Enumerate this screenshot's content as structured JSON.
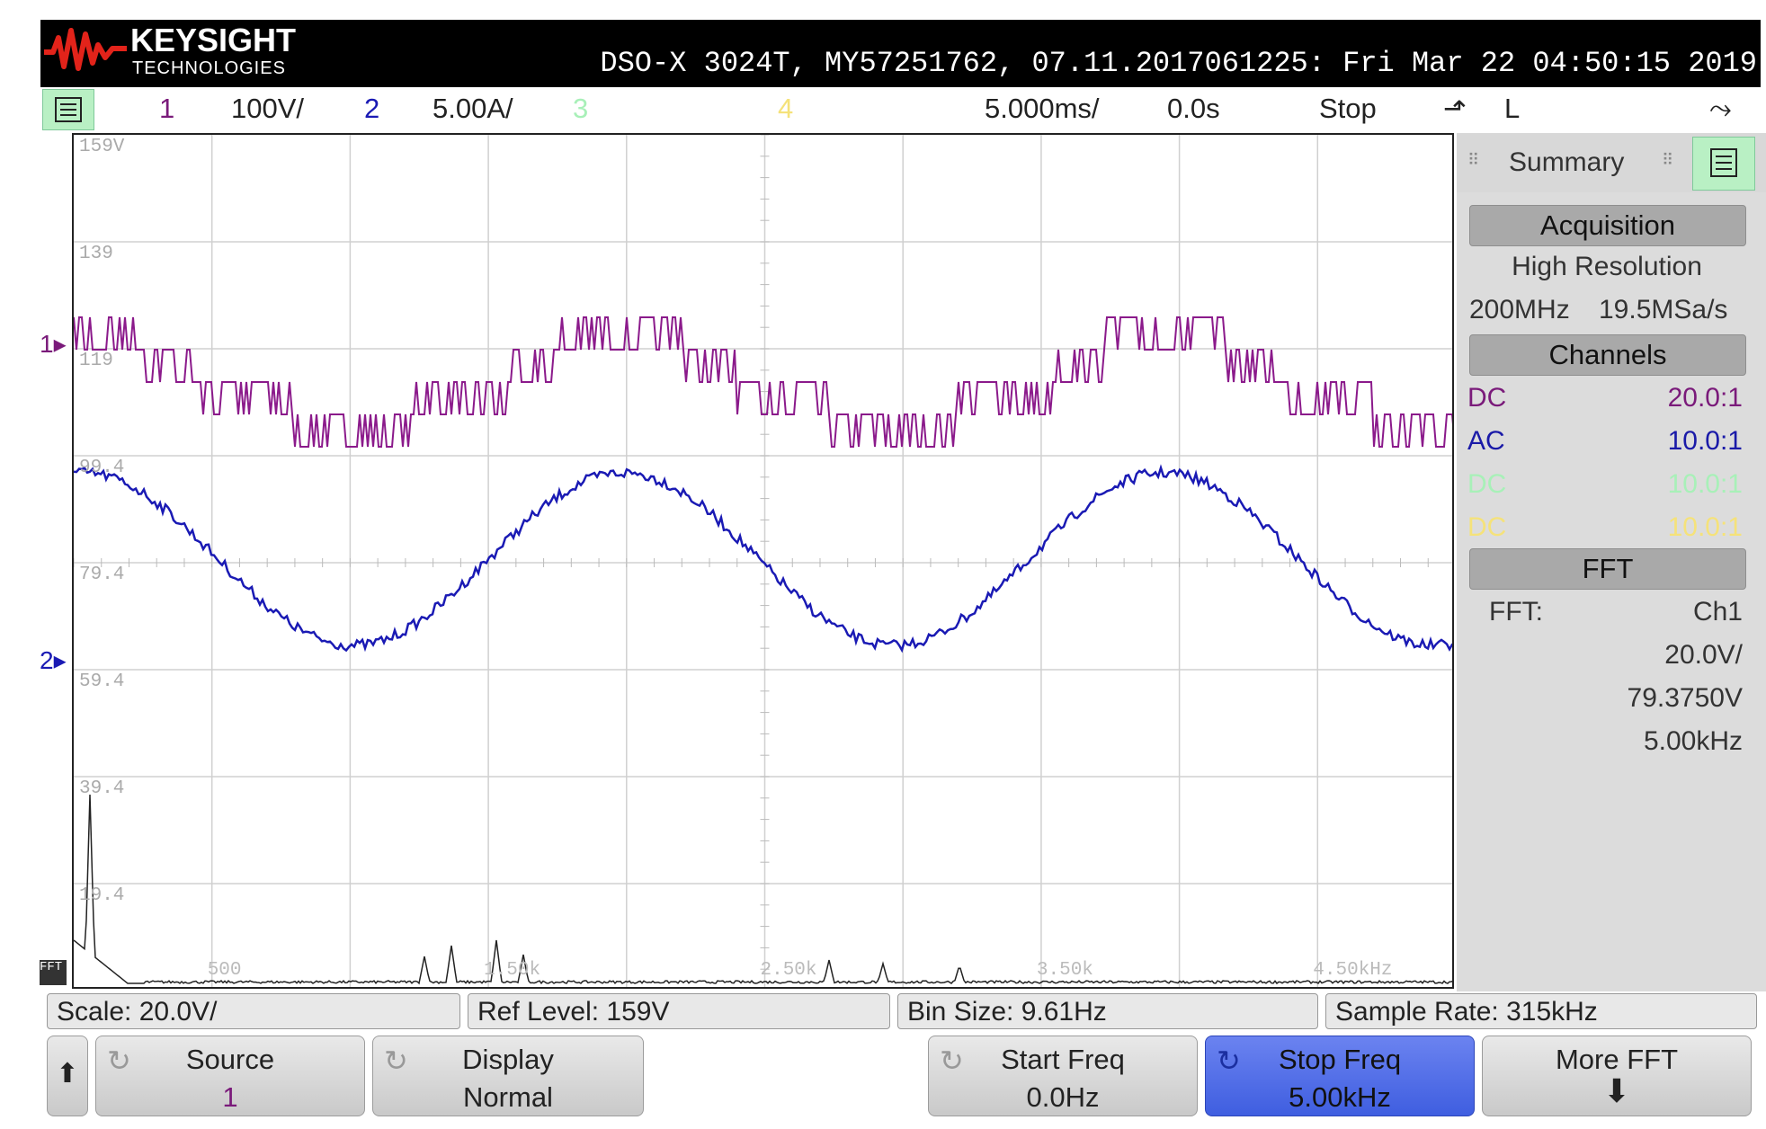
{
  "header": {
    "brand": "KEYSIGHT",
    "brand_sub": "TECHNOLOGIES",
    "instrument": "DSO-X 3024T, MY57251762, 07.11.2017061225: Fri Mar 22 04:50:15 2019"
  },
  "status": {
    "ch1_num": "1",
    "ch1_scale": "100V/",
    "ch2_num": "2",
    "ch2_scale": "5.00A/",
    "ch3_num": "3",
    "ch4_num": "4",
    "timebase": "5.000ms/",
    "delay": "0.0s",
    "run_state": "Stop",
    "trigger_slope": "⬏",
    "trigger_level": "L",
    "trigger_icon": "⤳"
  },
  "graticule": {
    "y_labels": [
      "159V",
      "139",
      "119",
      "99.4",
      "79.4",
      "59.4",
      "39.4",
      "19.4"
    ],
    "fft_labels": [
      "500",
      "1.50k",
      "2.50k",
      "3.50k",
      "4.50kHz"
    ]
  },
  "summary": {
    "title": "Summary",
    "acquisition_title": "Acquisition",
    "acq_mode": "High Resolution",
    "bandwidth": "200MHz",
    "sample_rate": "19.5MSa/s",
    "channels_title": "Channels",
    "channels": [
      {
        "coupling": "DC",
        "probe": "20.0:1",
        "color": "#7a1a7a"
      },
      {
        "coupling": "AC",
        "probe": "10.0:1",
        "color": "#1a1aa8"
      },
      {
        "coupling": "DC",
        "probe": "10.0:1",
        "color": "#a8f0b8"
      },
      {
        "coupling": "DC",
        "probe": "10.0:1",
        "color": "#f5e27a"
      }
    ],
    "fft_title": "FFT",
    "fft_label": "FFT:",
    "fft_source": "Ch1",
    "fft_scale": "20.0V/",
    "fft_ref": "79.3750V",
    "fft_span": "5.00kHz"
  },
  "info_bar": {
    "scale": "Scale: 20.0V/",
    "ref_level": "Ref Level: 159V",
    "bin_size": "Bin Size: 9.61Hz",
    "sample_rate": "Sample Rate: 315kHz"
  },
  "softkeys": {
    "back_icon": "⬆",
    "source_label": "Source",
    "source_value": "1",
    "display_label": "Display",
    "display_value": "Normal",
    "start_label": "Start Freq",
    "start_value": "0.0Hz",
    "stop_label": "Stop Freq",
    "stop_value": "5.00kHz",
    "more_label": "More FFT",
    "more_icon": "⬇"
  },
  "colors": {
    "ch1": "#8b1a8b",
    "ch2": "#1a1ab4",
    "fft": "#222222",
    "selected_softkey": "#4a66e8",
    "menu_green": "#b9f0c4"
  },
  "markers": {
    "ch1_marker": "1",
    "ch2_marker": "2",
    "fft_tag": "FFT"
  }
}
